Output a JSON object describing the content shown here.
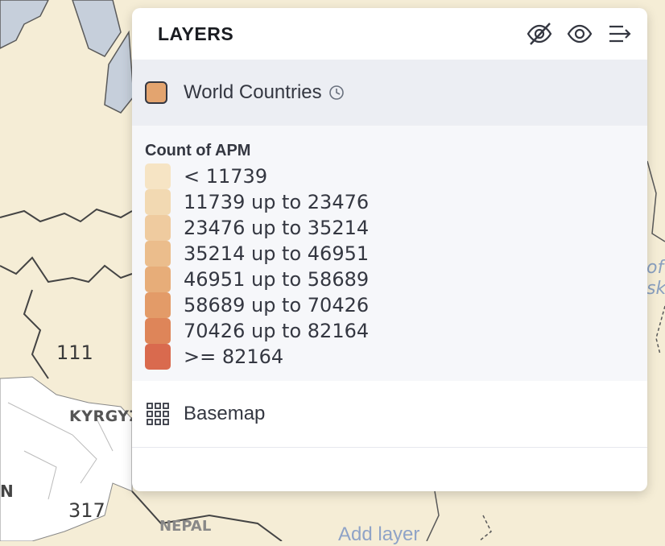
{
  "map": {
    "labels": {
      "num_111": "111",
      "num_317": "317",
      "country_kyrgyz": "KYRGYZ",
      "country_n": "N",
      "country_nepal": "NEPAL",
      "sea_partial": "of\nsk"
    },
    "add_layer": "Add layer",
    "colors": {
      "land": "#f5edd6",
      "water": "#c6cfdb",
      "border": "#5a5a5a"
    }
  },
  "panel": {
    "title": "LAYERS",
    "icons": [
      "eye-closed-icon",
      "eye-icon",
      "collapse-panel-icon"
    ]
  },
  "layer": {
    "name": "World Countries",
    "swatch_color": "#e3a46f",
    "icon": "clock-icon"
  },
  "legend": {
    "title": "Count of APM",
    "items": [
      {
        "label": "< 11739",
        "color": "#f6e4c4"
      },
      {
        "label": "11739 up to 23476",
        "color": "#f2d9b2"
      },
      {
        "label": "23476 up to 35214",
        "color": "#efcb9f"
      },
      {
        "label": "35214 up to 46951",
        "color": "#ebbd8c"
      },
      {
        "label": "46951 up to 58689",
        "color": "#e7ad79"
      },
      {
        "label": "58689 up to 70426",
        "color": "#e39b68"
      },
      {
        "label": "70426 up to 82164",
        "color": "#de8559"
      },
      {
        "label": ">= 82164",
        "color": "#d96a4e"
      }
    ]
  },
  "basemap": {
    "name": "Basemap",
    "icon": "grid-icon"
  }
}
